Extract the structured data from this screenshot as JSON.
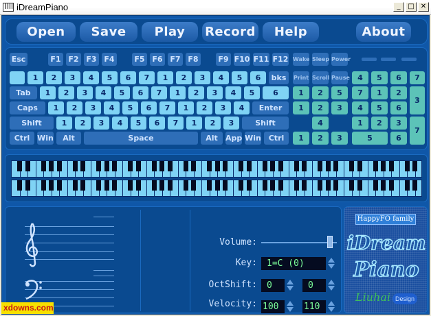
{
  "window": {
    "title": "iDreamPiano",
    "minimize": "_",
    "maximize": "□",
    "close": "✕"
  },
  "toolbar": {
    "open": "Open",
    "save": "Save",
    "play": "Play",
    "record": "Record",
    "help": "Help",
    "about": "About"
  },
  "keyboard": {
    "func_row": [
      "Esc",
      "F1",
      "F2",
      "F3",
      "F4",
      "F5",
      "F6",
      "F7",
      "F8",
      "F9",
      "F10",
      "F11",
      "F12"
    ],
    "power_keys": [
      "Wake",
      "Sleep",
      "Power"
    ],
    "row1": [
      "1",
      "2",
      "3",
      "4",
      "5",
      "6",
      "7",
      "1",
      "2",
      "3",
      "4",
      "5",
      "6"
    ],
    "bks": "bks",
    "nav1": [
      "Print",
      "Scroll",
      "Pause"
    ],
    "num1": [
      "4",
      "5",
      "6",
      "7"
    ],
    "tab": "Tab",
    "row2": [
      "1",
      "2",
      "3",
      "4",
      "5",
      "6",
      "7",
      "1",
      "2",
      "3",
      "4",
      "5",
      "6"
    ],
    "nav2": [
      "1",
      "2",
      "5"
    ],
    "num2": [
      "7",
      "1",
      "2"
    ],
    "num_plus": "3",
    "caps": "Caps",
    "row3": [
      "1",
      "2",
      "3",
      "4",
      "5",
      "6",
      "7",
      "1",
      "2",
      "3",
      "4"
    ],
    "enter": "Enter",
    "nav3": [
      "1",
      "2",
      "3"
    ],
    "num3": [
      "4",
      "5",
      "6"
    ],
    "shift_l": "Shift",
    "row4": [
      "1",
      "2",
      "3",
      "4",
      "5",
      "6",
      "7",
      "1",
      "2",
      "3"
    ],
    "shift_r": "Shift",
    "nav_up": "4",
    "num4": [
      "1",
      "2",
      "3"
    ],
    "num_enter": "7",
    "ctrl_l": "Ctrl",
    "win_l": "Win",
    "alt_l": "Alt",
    "space": "Space",
    "alt_r": "Alt",
    "app": "App",
    "win_r": "Win",
    "ctrl_r": "Ctrl",
    "nav4": [
      "1",
      "2",
      "3"
    ],
    "num5": [
      "5",
      "6"
    ]
  },
  "controls": {
    "volume_label": "Volume:",
    "key_label": "Key:",
    "key_value": "1=C (0)",
    "octshift_label": "OctShift:",
    "octshift_left": "0",
    "octshift_right": "0",
    "velocity_label": "Velocity:",
    "velocity_left": "100",
    "velocity_right": "110"
  },
  "logo": {
    "family": "HappyFO family",
    "line1": "iDream",
    "line2": "Piano",
    "author": "Liuhai",
    "design": "Design"
  },
  "watermark": "xdowns.com",
  "colors": {
    "app_bg": "#0f57a8",
    "note_key": "#7fd3f5",
    "teal_key": "#5cc3b8",
    "lcd_text": "#7cff9a"
  }
}
